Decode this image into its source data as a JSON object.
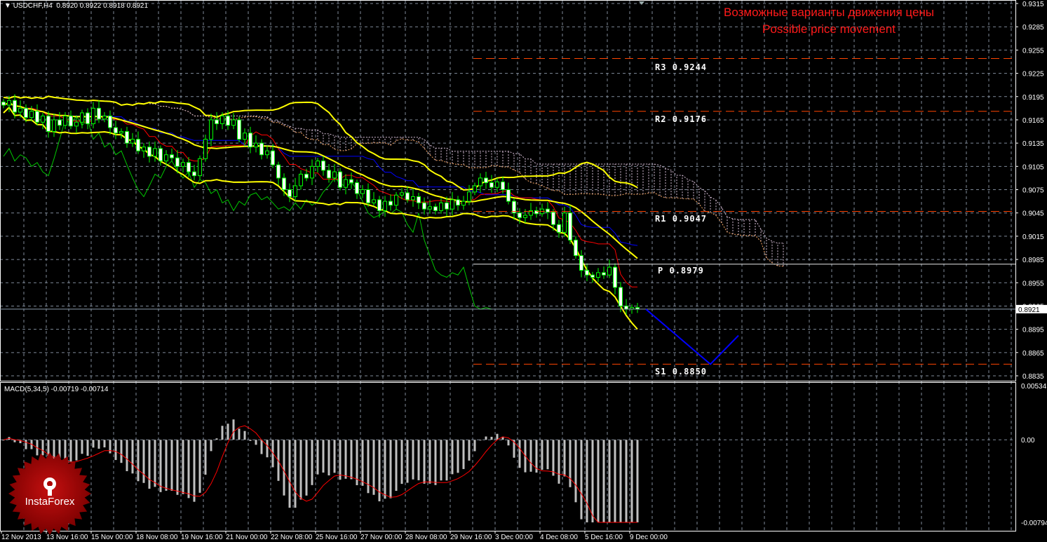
{
  "header": {
    "symbol": "USDCHF,H4",
    "ohlc": "0.8920 0.8922 0.8918 0.8921",
    "macd_label": "MACD(5,34,5) -0.00719 -0.00714"
  },
  "title": {
    "ru": "Возможные варианты движения цены",
    "en": "Possible price movement"
  },
  "logo": {
    "text": "InstaForex"
  },
  "colors": {
    "background": "#000000",
    "grid": "#7f8a99",
    "candle": "#00ff00",
    "bollinger": "#ffff00",
    "tenkan": "#ff0000",
    "kijun": "#0000ff",
    "chikou": "#00c800",
    "cloud_up": "#f4a460",
    "cloud_down": "#d8bfd8",
    "pivot_line": "#ff4500",
    "pivot_p": "#ffd700",
    "projection": "#0000ff",
    "macd_hist": "#c0c0c0",
    "macd_signal": "#ff0000",
    "title": "#ff0000"
  },
  "levels": [
    {
      "label": "R3",
      "value": "0.9244"
    },
    {
      "label": "R2",
      "value": "0.9176"
    },
    {
      "label": "R1",
      "value": "0.9047"
    },
    {
      "label": "P",
      "value": "0.8979"
    },
    {
      "label": "S1",
      "value": "0.8850"
    }
  ],
  "current_price": "0.8921",
  "chart_data": {
    "type": "candlestick",
    "symbol": "USDCHF",
    "timeframe": "H4",
    "closes": [
      0.9184,
      0.919,
      0.9175,
      0.918,
      0.9168,
      0.9176,
      0.9162,
      0.917,
      0.915,
      0.9165,
      0.9158,
      0.917,
      0.9157,
      0.9162,
      0.9174,
      0.916,
      0.918,
      0.9166,
      0.917,
      0.9155,
      0.9148,
      0.915,
      0.9135,
      0.914,
      0.9125,
      0.913,
      0.9118,
      0.9128,
      0.9112,
      0.912,
      0.9116,
      0.9105,
      0.911,
      0.9098,
      0.9093,
      0.9115,
      0.914,
      0.9165,
      0.916,
      0.917,
      0.9158,
      0.9165,
      0.914,
      0.9148,
      0.913,
      0.9135,
      0.912,
      0.9125,
      0.9107,
      0.909,
      0.9075,
      0.9066,
      0.908,
      0.9095,
      0.909,
      0.9105,
      0.9112,
      0.91,
      0.909,
      0.9098,
      0.9078,
      0.9088,
      0.9084,
      0.907,
      0.9075,
      0.9058,
      0.9062,
      0.9048,
      0.906,
      0.9055,
      0.9068,
      0.9071,
      0.9062,
      0.9066,
      0.9058,
      0.905,
      0.9053,
      0.9048,
      0.9058,
      0.905,
      0.9062,
      0.9055,
      0.906,
      0.9072,
      0.908,
      0.909,
      0.9084,
      0.9078,
      0.9085,
      0.9075,
      0.906,
      0.9045,
      0.9039,
      0.9042,
      0.9048,
      0.9044,
      0.905,
      0.9046,
      0.903,
      0.902,
      0.9045,
      0.901,
      0.899,
      0.8971,
      0.8965,
      0.8962,
      0.8968,
      0.8965,
      0.8975,
      0.8949,
      0.8925,
      0.8921,
      0.8923,
      0.8921
    ],
    "price_ticks": [
      "0.9315",
      "0.9285",
      "0.9255",
      "0.9225",
      "0.9195",
      "0.9165",
      "0.9135",
      "0.9105",
      "0.9075",
      "0.9045",
      "0.9015",
      "0.8985",
      "0.8955",
      "0.8925",
      "0.8895",
      "0.8865",
      "0.8835"
    ],
    "price_range": [
      0.8835,
      0.9315
    ],
    "macd_ticks": [
      "0.00534",
      "0.00",
      "-0.00794"
    ],
    "macd_range": [
      -0.00794,
      0.00534
    ],
    "time_labels": [
      "12 Nov 2013",
      "13 Nov 16:00",
      "15 Nov 00:00",
      "18 Nov 08:00",
      "19 Nov 16:00",
      "21 Nov 00:00",
      "22 Nov 08:00",
      "25 Nov 16:00",
      "27 Nov 00:00",
      "28 Nov 08:00",
      "29 Nov 16:00",
      "3 Dec 00:00",
      "4 Dec 08:00",
      "5 Dec 16:00",
      "9 Dec 00:00"
    ],
    "projection": [
      {
        "bar": 114.5,
        "price": 0.8921
      },
      {
        "bar": 126,
        "price": 0.885
      },
      {
        "bar": 131,
        "price": 0.8887
      }
    ],
    "indicators": [
      "Bollinger Bands",
      "Ichimoku",
      "MACD(5,34,5)"
    ],
    "grid": true
  }
}
